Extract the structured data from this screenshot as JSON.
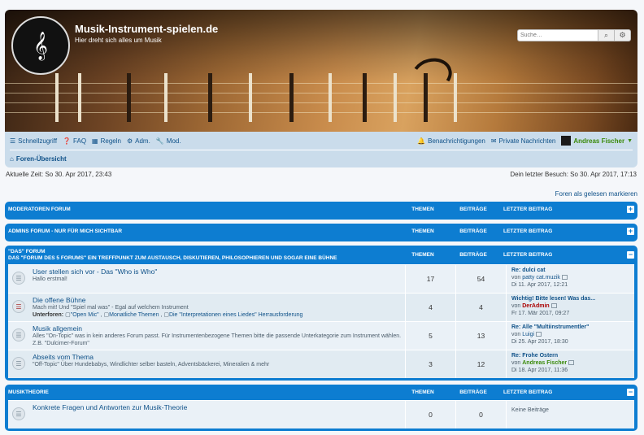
{
  "header": {
    "site_title": "Musik-Instrument-spielen.de",
    "site_desc": "Hier dreht sich alles um Musik",
    "search_placeholder": "Suche…"
  },
  "nav": {
    "quick": "Schnellzugriff",
    "faq": "FAQ",
    "rules": "Regeln",
    "adm": "Adm.",
    "mod": "Mod.",
    "notifications": "Benachrichtigungen",
    "pm": "Private Nachrichten",
    "user": "Andreas Fischer",
    "breadcrumb": "Foren-Übersicht"
  },
  "times": {
    "current": "Aktuelle Zeit: So 30. Apr 2017, 23:43",
    "last_visit": "Dein letzter Besuch: So 30. Apr 2017, 17:13",
    "mark_read": "Foren als gelesen markieren"
  },
  "columns": {
    "topics": "THEMEN",
    "posts": "BEITRÄGE",
    "last": "LETZTER BEITRAG"
  },
  "categories": [
    {
      "title": "MODERATOREN FORUM"
    },
    {
      "title": "ADMINS FORUM - NUR FÜR MICH SICHTBAR"
    },
    {
      "title": "\"DAS\" FORUM",
      "subtitle": "DAS \"FORUM DES 5 FORUMS\" EIN TREFFPUNKT ZUM AUSTAUSCH, DISKUTIEREN, PHILOSOPHIEREN UND SOGAR EINE BÜHNE"
    },
    {
      "title": "MUSIKTHEORIE"
    }
  ],
  "forums": [
    {
      "name": "User stellen sich vor - Das \"Who is Who\"",
      "desc": "Hallo erstmal!",
      "topics": "17",
      "posts": "54",
      "last_title": "Re: dulci cat",
      "last_by_prefix": "von",
      "last_by": "patty cat.muzik",
      "last_date": "Di 11. Apr 2017, 12:21"
    },
    {
      "name": "Die offene Bühne",
      "desc": "Mach mit! Und \"Spiel mal was\" - Egal auf welchem Instrument",
      "sub_label": "Unterforen:",
      "sub_1": "\"Open Mic\"",
      "sub_2": "Monatliche Themen",
      "sub_3": "Die \"Interpretationen eines Liedes\" Herrausforderung",
      "topics": "4",
      "posts": "4",
      "last_title": "Wichtig! Bitte lesen! Was das...",
      "last_by_prefix": "von",
      "last_by": "DerAdmin",
      "last_date": "Fr 17. Mär 2017, 09:27"
    },
    {
      "name": "Musik allgemein",
      "desc": "Alles \"On-Topic\" was in kein anderes Forum passt. Für Instrumentenbezogene Themen bitte die passende Unterkategorie zum Instrument wählen. Z.B. \"Dulcimer-Forum\"",
      "topics": "5",
      "posts": "13",
      "last_title": "Re: Alle \"Multiinstrumentler\"",
      "last_by_prefix": "von",
      "last_by": "Luigi",
      "last_date": "Di 25. Apr 2017, 18:30"
    },
    {
      "name": "Abseits vom Thema",
      "desc": "\"Off-Topic\" Über Hundebabys, Windlichter selber basteln, Adventsbäckerei, Mineralien & mehr",
      "topics": "3",
      "posts": "12",
      "last_title": "Re: Frohe Ostern",
      "last_by_prefix": "von",
      "last_by": "Andreas Fischer",
      "last_date": "Di 18. Apr 2017, 11:36"
    },
    {
      "name": "Konkrete Fragen und Antworten zur Musik-Theorie",
      "topics": "0",
      "posts": "0",
      "last_none": "Keine Beiträge"
    }
  ],
  "icons": {
    "search": "search-icon",
    "settings": "gear-icon",
    "bars": "bars-icon",
    "question": "question-icon",
    "book": "book-icon",
    "cogs": "cogs-icon",
    "wrench": "wrench-icon",
    "bell": "bell-icon",
    "inbox": "inbox-icon",
    "home": "home-icon",
    "forum": "forum-read-icon",
    "plus": "plus-icon",
    "minus": "minus-icon"
  },
  "colors": {
    "category_blue": "#0d7dd1",
    "navbar": "#cadceb",
    "link": "#105289",
    "user_green": "#3a8a0a",
    "admin_red": "#aa0000"
  }
}
